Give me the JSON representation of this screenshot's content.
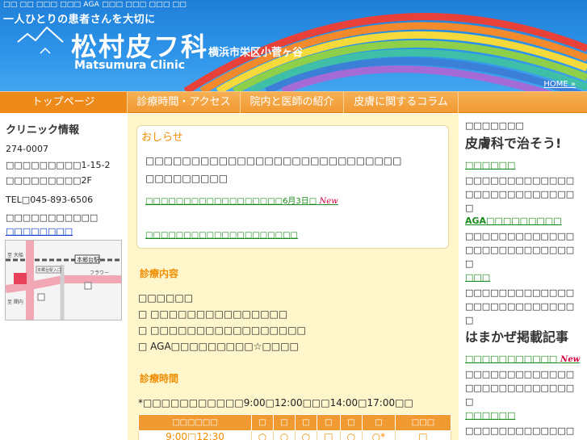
{
  "header": {
    "tagline_small": "□□ □□ □□□ □□□ AGA □□□ □□□ □□□ □□",
    "tagline": "一人ひとりの患者さんを大切に",
    "clinic_name": "松村皮フ科",
    "location": "横浜市栄区小菅ヶ谷",
    "clinic_name_roman": "Matsumura Clinic",
    "home_link": "HOME »"
  },
  "nav": {
    "items": [
      {
        "label": "トップページ"
      },
      {
        "label": "診療時間・アクセス"
      },
      {
        "label": "院内と医師の紹介"
      },
      {
        "label": "皮膚に関するコラム"
      }
    ]
  },
  "left": {
    "title": "クリニック情報",
    "lines": [
      "274-0007",
      "□□□□□□□□□1-15-2",
      "□□□□□□□□□2F",
      "TEL□045-893-6506",
      "□□□□□□□□□□□"
    ],
    "map_link": "□□□□□□□□",
    "map_labels": [
      "本郷台駅",
      "至 大船",
      "本郷台駅入口",
      "至 関内",
      "フラワー"
    ]
  },
  "notice": {
    "title": "おしらせ",
    "line1": "□□□□□□□□□□□□□□□□□□□□□□□□□□□□",
    "line2": "□□□□□□□□□",
    "link1": "□□□□□□□□□□□□□□□□□□6月3日□",
    "new1": "New",
    "link2": "□□□□□□□□□□□□□□□□□□□□"
  },
  "sections": {
    "treatment_title": "診療内容",
    "treatment_lines": [
      "□□□□□□",
      "□ □□□□□□□□□□□□□□□",
      "□ □□□□□□□□□□□□□□□□□",
      "□ AGA□□□□□□□□□☆□□□□"
    ],
    "hours_title": "診療時間",
    "hours_note": "*□□□□□□□□□□□9:00□12:00□□□14:00□17:00□□"
  },
  "hours_table": {
    "headers": [
      "□□□□□□",
      "□",
      "□",
      "□",
      "□",
      "□",
      "□",
      "□□□"
    ],
    "row1": [
      "9:00□12:30",
      "○",
      "○",
      "○",
      "□",
      "○",
      "○*",
      "□"
    ]
  },
  "right": {
    "intro": "□□□□□□□",
    "headline": "皮膚科で治そう!",
    "items": [
      {
        "link": "□□□□□□",
        "text": "□□□□□□□□□□□□□□□□□□□□□□□□□□□"
      },
      {
        "link": "AGA□□□□□□□□□",
        "text": "□□□□□□□□□□□□□□□□□□□□□□□□□□□"
      },
      {
        "link": "□□□",
        "text": "□□□□□□□□□□□□□□□□□□□□□□□□□□□"
      }
    ],
    "section2_title": "はまかぜ掲載記事",
    "section2_items": [
      {
        "link": "□□□□□□□□□□□",
        "new": "New",
        "text": "□□□□□□□□□□□□□□□□□□□□□□□□□□□"
      },
      {
        "link": "□□□□□□",
        "text": "□□□□□□□□□□□□□□□□□"
      }
    ]
  }
}
